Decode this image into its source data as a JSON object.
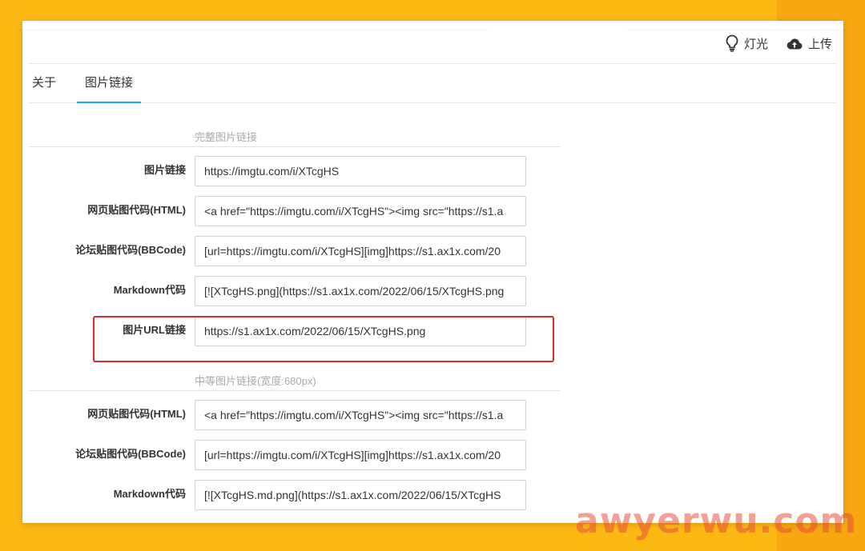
{
  "header": {
    "light_label": "灯光",
    "upload_label": "上传"
  },
  "tabs": [
    {
      "label": "关于"
    },
    {
      "label": "图片链接"
    }
  ],
  "sections": [
    {
      "title": "完整图片链接",
      "rows": [
        {
          "label": "图片链接",
          "value": "https://imgtu.com/i/XTcgHS"
        },
        {
          "label": "网页贴图代码(HTML)",
          "value": "<a href=\"https://imgtu.com/i/XTcgHS\"><img src=\"https://s1.a"
        },
        {
          "label": "论坛贴图代码(BBCode)",
          "value": "[url=https://imgtu.com/i/XTcgHS][img]https://s1.ax1x.com/20"
        },
        {
          "label": "Markdown代码",
          "value": "[![XTcgHS.png](https://s1.ax1x.com/2022/06/15/XTcgHS.png"
        },
        {
          "label": "图片URL链接",
          "value": "https://s1.ax1x.com/2022/06/15/XTcgHS.png"
        }
      ]
    },
    {
      "title": "中等图片链接(宽度:680px)",
      "rows": [
        {
          "label": "网页贴图代码(HTML)",
          "value": "<a href=\"https://imgtu.com/i/XTcgHS\"><img src=\"https://s1.a"
        },
        {
          "label": "论坛贴图代码(BBCode)",
          "value": "[url=https://imgtu.com/i/XTcgHS][img]https://s1.ax1x.com/20"
        },
        {
          "label": "Markdown代码",
          "value": "[![XTcgHS.md.png](https://s1.ax1x.com/2022/06/15/XTcgHS"
        }
      ]
    }
  ],
  "watermark": "awyerwu.com",
  "colors": {
    "background": "#FDB913",
    "tab_active": "#1E9FFF",
    "highlight": "#E8252A"
  }
}
